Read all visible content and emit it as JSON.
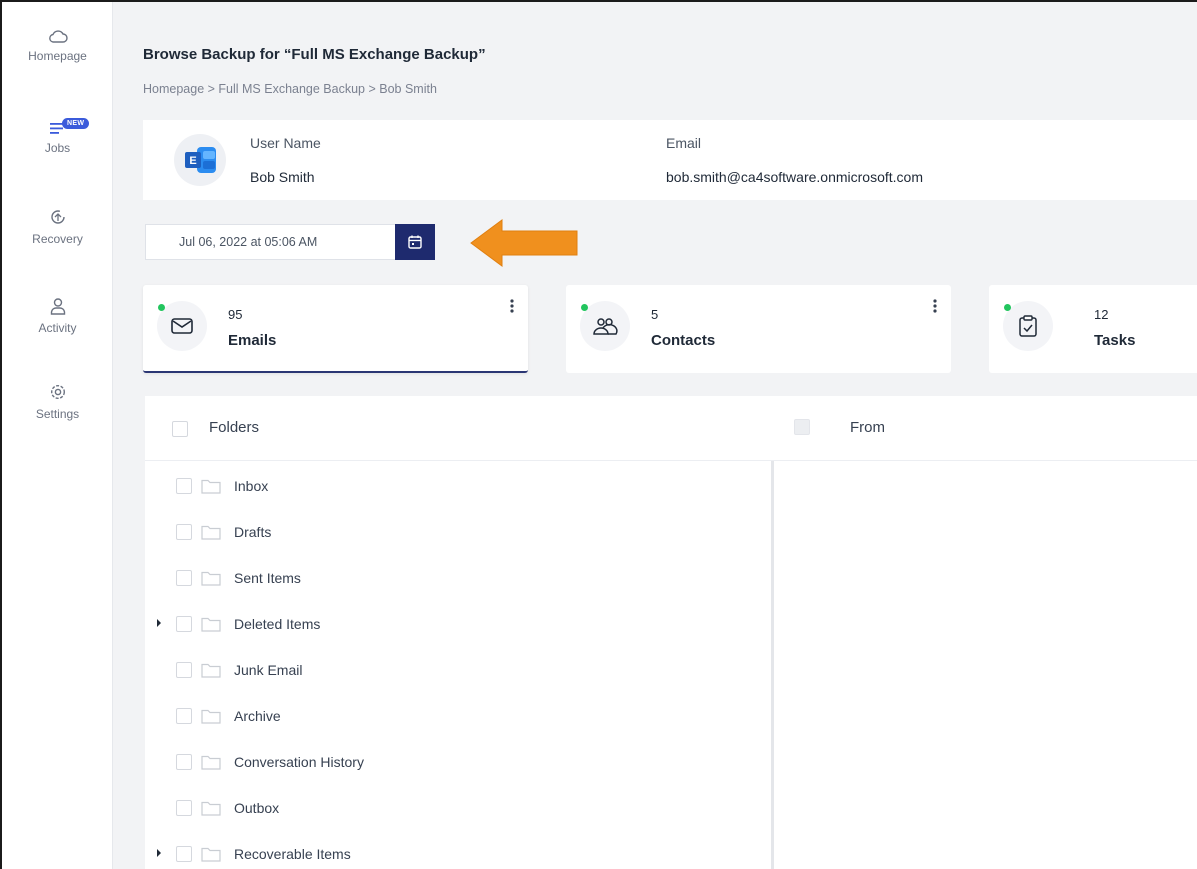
{
  "sidebar": {
    "items": [
      {
        "label": "Homepage",
        "icon": "cloud-icon"
      },
      {
        "label": "Jobs",
        "icon": "list-icon",
        "badge": "NEW"
      },
      {
        "label": "Recovery",
        "icon": "recovery-icon"
      },
      {
        "label": "Activity",
        "icon": "user-icon"
      },
      {
        "label": "Settings",
        "icon": "gear-icon"
      }
    ]
  },
  "header": {
    "title": "Browse Backup for “Full MS Exchange Backup”",
    "breadcrumb": "Homepage > Full MS Exchange Backup > Bob Smith"
  },
  "user": {
    "name_label": "User Name",
    "name": "Bob Smith",
    "email_label": "Email",
    "email": "bob.smith@ca4software.onmicrosoft.com",
    "avatar_icon": "exchange-icon"
  },
  "date_picker": {
    "value": "Jul 06, 2022 at 05:06 AM",
    "icon": "calendar-icon"
  },
  "annotation": {
    "arrow_color": "#f0901e"
  },
  "stats": [
    {
      "count": "95",
      "label": "Emails",
      "icon": "mail-icon"
    },
    {
      "count": "5",
      "label": "Contacts",
      "icon": "contacts-icon"
    },
    {
      "count": "12",
      "label": "Tasks",
      "icon": "tasks-icon"
    }
  ],
  "table": {
    "folders_header": "Folders",
    "from_header": "From",
    "folders": [
      {
        "name": "Inbox",
        "expandable": false
      },
      {
        "name": "Drafts",
        "expandable": false
      },
      {
        "name": "Sent Items",
        "expandable": false
      },
      {
        "name": "Deleted Items",
        "expandable": true
      },
      {
        "name": "Junk Email",
        "expandable": false
      },
      {
        "name": "Archive",
        "expandable": false
      },
      {
        "name": "Conversation History",
        "expandable": false
      },
      {
        "name": "Outbox",
        "expandable": false
      },
      {
        "name": "Recoverable Items",
        "expandable": true
      }
    ]
  },
  "colors": {
    "accent_navy": "#1e2a6e",
    "status_green": "#22c55e",
    "badge_blue": "#3b5bdb"
  }
}
